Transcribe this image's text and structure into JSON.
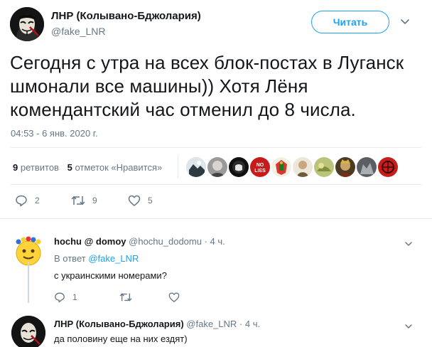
{
  "tweet": {
    "author_name": "ЛНР (Колывано-Бджолария)",
    "author_handle": "@fake_LNR",
    "follow_label": "Читать",
    "text": "Сегодня с утра на всех блок-постах в Луганск шмонали все машины)) Хотя Лёня комендантский час отменил до 8 числа.",
    "timestamp": "04:53 - 6 янв. 2020 г.",
    "retweets_count": "9",
    "retweets_label": "ретвитов",
    "likes_count": "5",
    "likes_label": "отметок «Нравится»",
    "liker_avatars": [
      "avatar-1",
      "avatar-2",
      "avatar-3",
      "avatar-4",
      "avatar-5",
      "avatar-6",
      "avatar-7",
      "avatar-8",
      "avatar-9",
      "avatar-10"
    ],
    "actions": {
      "reply_count": "2",
      "retweet_count": "9",
      "like_count": "5"
    }
  },
  "replies": [
    {
      "author_name": "hochu @ domoy",
      "author_handle": "@hochu_dodomu",
      "time": "· 4 ч.",
      "reply_to_prefix": "В ответ",
      "reply_to_handle": "@fake_LNR",
      "text": "с украинскими номерами?",
      "reply_count": "1"
    },
    {
      "author_name": "ЛНР (Колывано-Бджолария)",
      "author_handle": "@fake_LNR",
      "time": "· 4 ч.",
      "text": "да половину еще на них ездят)"
    }
  ],
  "colors": {
    "accent": "#1da1f2",
    "text": "#14171a",
    "secondary": "#657786",
    "divider": "#e6ecf0"
  }
}
